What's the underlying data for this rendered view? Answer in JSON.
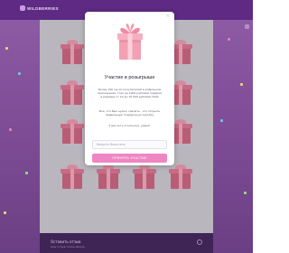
{
  "header": {
    "logo_text": "WILDBERRIES"
  },
  "modal": {
    "close_label": "×",
    "title": "Участие в розыгрыше",
    "paragraph_1": "Более 150 тысяч покупателей в мобильном приложении, стал на 1000 рублями подарка в размере от 10 до 10 000 рублями США",
    "paragraph_2": "Все, что Вам нужно сделать - это открыть правильную подарочную коробку",
    "paragraph_3": "У вас есть 3 попытки, удачи!",
    "input_placeholder": "Введите Ваше имя",
    "submit_label": "ПРИНЯТЬ УЧАСТИЕ"
  },
  "footer": {
    "title": "Оставить отзыв",
    "subtitle": "ваш отзыв очень важен"
  },
  "colors": {
    "header": "#5e2a83",
    "accent_button": "#ee86c3",
    "gift": "#f3a0b3"
  }
}
